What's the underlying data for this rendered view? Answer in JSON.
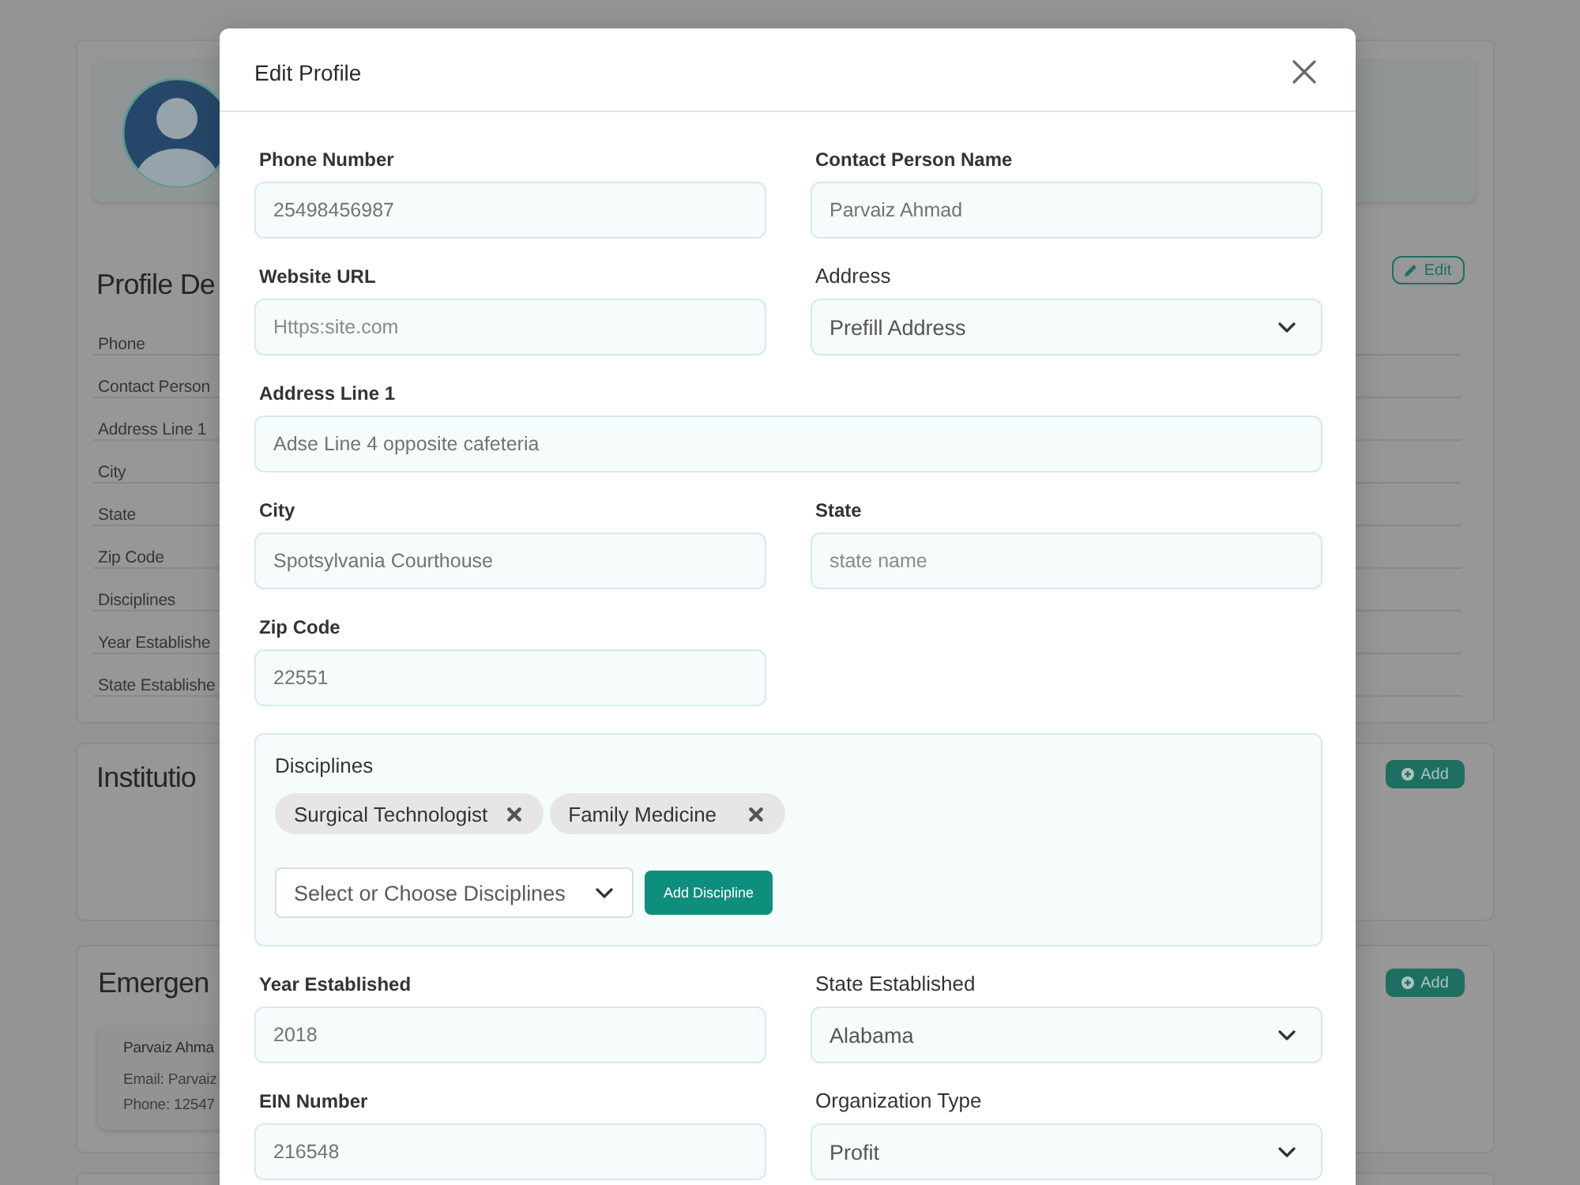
{
  "background_page": {
    "profile_card": {
      "title": "Profile De",
      "edit_button": "Edit",
      "rows": [
        "Phone",
        "Contact Person",
        "Address Line 1",
        "City",
        "State",
        "Zip Code",
        "Disciplines",
        "Year Establishe",
        "State Establishe"
      ]
    },
    "institution_card": {
      "title": "Institutio",
      "add_button": "Add"
    },
    "emergency_card": {
      "title": "Emergen",
      "add_button": "Add",
      "contact": {
        "name": "Parvaiz Ahma",
        "email": "Email: Parvaiz",
        "phone": "Phone: 12547"
      }
    }
  },
  "modal": {
    "title": "Edit Profile",
    "sections": [
      {
        "kind": "pair",
        "fields": [
          {
            "kind": "input",
            "label": "Phone Number",
            "value": "25498456987"
          },
          {
            "kind": "input",
            "label": "Contact Person Name",
            "value": "Parvaiz Ahmad"
          }
        ]
      },
      {
        "kind": "pair",
        "fields": [
          {
            "kind": "input",
            "label": "Website URL",
            "placeholder": "Https:site.com"
          },
          {
            "kind": "select",
            "label": "Address",
            "value": "Prefill Address"
          }
        ]
      },
      {
        "kind": "wide",
        "fields": [
          {
            "kind": "input",
            "label": "Address Line 1",
            "value": "Adse Line 4 opposite cafeteria"
          }
        ]
      },
      {
        "kind": "pair",
        "fields": [
          {
            "kind": "input",
            "label": "City",
            "value": "Spotsylvania Courthouse"
          },
          {
            "kind": "input",
            "label": "State",
            "placeholder": "state name"
          }
        ]
      },
      {
        "kind": "pair",
        "fields": [
          {
            "kind": "input",
            "label": "Zip Code",
            "value": "22551"
          }
        ]
      },
      {
        "kind": "disciplines",
        "label": "Disciplines",
        "chips": [
          "Surgical Technologist",
          "Family Medicine"
        ],
        "placeholder": "Select or Choose Disciplines",
        "button": "Add Discipline"
      },
      {
        "kind": "pair",
        "fields": [
          {
            "kind": "input",
            "label": "Year Established",
            "value": "2018"
          },
          {
            "kind": "select",
            "label": "State Established",
            "value": "Alabama"
          }
        ]
      },
      {
        "kind": "pair",
        "fields": [
          {
            "kind": "input",
            "label": "EIN Number",
            "value": "216548"
          },
          {
            "kind": "select",
            "label": "Organization Type",
            "value": "Profit"
          }
        ]
      }
    ]
  }
}
